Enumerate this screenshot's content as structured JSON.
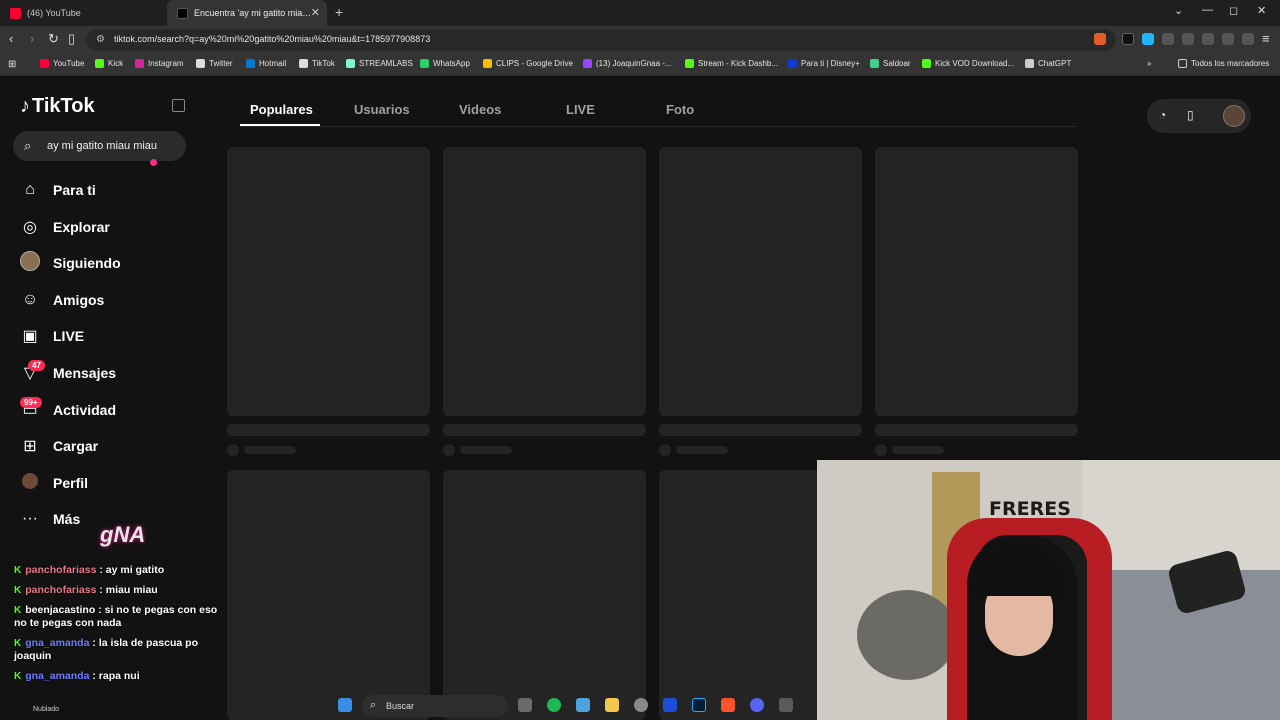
{
  "browser": {
    "tabs": [
      {
        "label": "(46) YouTube"
      },
      {
        "label": "Encuentra 'ay mi gatito miau miau'"
      }
    ],
    "url": "tiktok.com/search?q=ay%20mi%20gatito%20miau%20miau&t=1785977908873",
    "bookmarks": [
      {
        "label": "YouTube",
        "color": "#ff0033"
      },
      {
        "label": "Kick",
        "color": "#53fc18"
      },
      {
        "label": "Instagram",
        "color": "#d6249f"
      },
      {
        "label": "Twitter",
        "color": "#ffffff"
      },
      {
        "label": "Hotmail",
        "color": "#0078d4"
      },
      {
        "label": "TikTok",
        "color": "#ffffff"
      },
      {
        "label": "STREAMLABS",
        "color": "#80f5d2"
      },
      {
        "label": "WhatsApp",
        "color": "#25d366"
      },
      {
        "label": "CLIPS - Google Drive",
        "color": "#fbbc04"
      },
      {
        "label": "(13) JoaquinGnaa -...",
        "color": "#9146ff"
      },
      {
        "label": "Stream - Kick Dashb...",
        "color": "#53fc18"
      },
      {
        "label": "Para ti | Disney+",
        "color": "#113ccf"
      },
      {
        "label": "Saldoar",
        "color": "#3ecf8e"
      },
      {
        "label": "Kick VOD Download...",
        "color": "#53fc18"
      },
      {
        "label": "ChatGPT",
        "color": "#cccccc"
      }
    ],
    "all_bookmarks": "Todos los marcadores"
  },
  "tiktok": {
    "logo": "TikTok",
    "search_value": "ay mi gatito miau miau",
    "nav": [
      {
        "label": "Para ti",
        "icon": "home-icon",
        "glyph": "⌂"
      },
      {
        "label": "Explorar",
        "icon": "compass-icon",
        "glyph": "◎"
      },
      {
        "label": "Siguiendo",
        "icon": "avatar-icon",
        "glyph": ""
      },
      {
        "label": "Amigos",
        "icon": "friends-icon",
        "glyph": "☺"
      },
      {
        "label": "LIVE",
        "icon": "live-icon",
        "glyph": "▣"
      },
      {
        "label": "Mensajes",
        "icon": "inbox-icon",
        "glyph": "▽"
      },
      {
        "label": "Actividad",
        "icon": "activity-icon",
        "glyph": "▭"
      },
      {
        "label": "Cargar",
        "icon": "upload-icon",
        "glyph": "⊞"
      },
      {
        "label": "Perfil",
        "icon": "profile-icon",
        "glyph": ""
      },
      {
        "label": "Más",
        "icon": "more-icon",
        "glyph": "···"
      }
    ],
    "badges": {
      "messages": "47",
      "activity": "99+"
    },
    "tabs": [
      "Populares",
      "Usuarios",
      "Videos",
      "LIVE",
      "Foto"
    ],
    "active_tab": "Populares"
  },
  "overlay": {
    "logo_text": "gNA",
    "chat": [
      {
        "user": "panchofariass",
        "text": "ay mi gatito",
        "pink": true
      },
      {
        "user": "panchofariass",
        "text": "miau miau",
        "pink": true
      },
      {
        "user": "beenjacastino",
        "text": "si no te pegas con eso no te pegas con nada",
        "pink": false,
        "white": true
      },
      {
        "user": "gna_amanda",
        "text": "la isla de pascua po joaquin",
        "pink": false
      },
      {
        "user": "gna_amanda",
        "text": "rapa nui",
        "pink": false
      }
    ],
    "cam_sign": "FRERES"
  },
  "taskbar": {
    "search_label": "Buscar",
    "weather": "Nublado"
  }
}
